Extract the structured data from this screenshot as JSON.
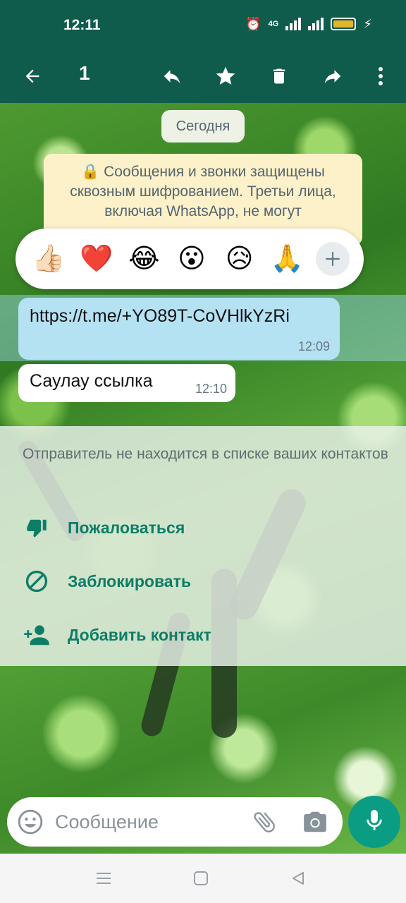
{
  "status_bar": {
    "time": "12:11",
    "network_label": "4G",
    "battery_color": "#e3b52a"
  },
  "toolbar": {
    "selected_count": "1",
    "icons": [
      "back-arrow-icon",
      "reply-icon",
      "star-icon",
      "delete-icon",
      "forward-icon",
      "more-vert-icon"
    ]
  },
  "chat": {
    "date_chip": "Сегодня",
    "encryption_notice": "Сообщения и звонки защищены сквозным шифрованием. Третьи лица, включая WhatsApp, не могут",
    "reactions": [
      "👍🏻",
      "❤️",
      "😂",
      "😮",
      "😥",
      "🙏"
    ],
    "messages": [
      {
        "text": "https://t.me/+YO89T-CoVHlkYzRi",
        "time": "12:09",
        "selected": true
      },
      {
        "text": "Саулау ссылка",
        "time": "12:10",
        "selected": false
      }
    ]
  },
  "unknown_sender": {
    "info": "Отправитель не находится в списке ваших контактов",
    "actions": [
      {
        "label": "Пожаловаться",
        "icon": "thumbs-down-icon"
      },
      {
        "label": "Заблокировать",
        "icon": "block-icon"
      },
      {
        "label": "Добавить контакт",
        "icon": "add-person-icon"
      }
    ]
  },
  "composer": {
    "placeholder": "Сообщение"
  },
  "colors": {
    "header": "#0f5c4c",
    "accent": "#0d7d67",
    "mic_button": "#0b9c84",
    "selected_bubble": "#b4e2f3"
  }
}
